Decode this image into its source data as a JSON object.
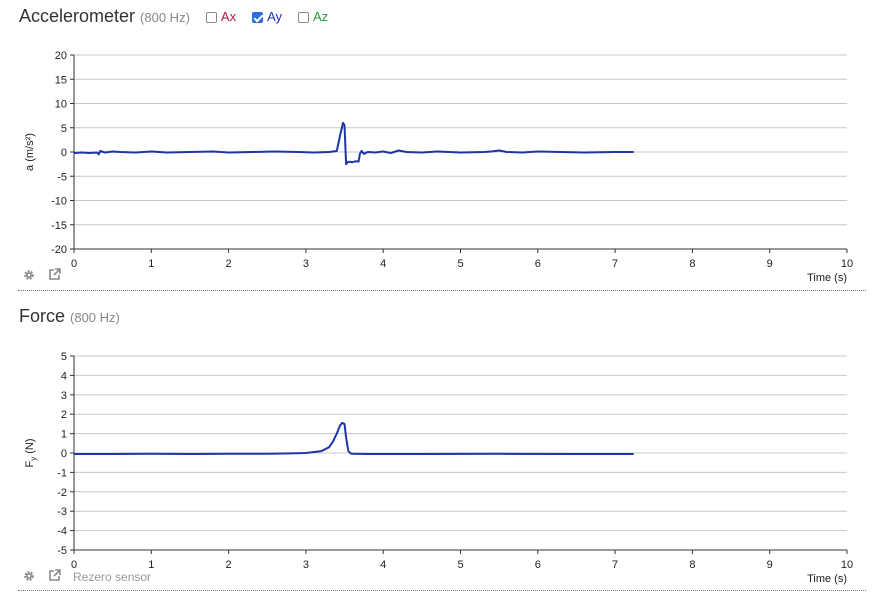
{
  "accelerometer": {
    "title": "Accelerometer",
    "rate": "(800 Hz)",
    "checkboxes": [
      {
        "label": "Ax",
        "checked": false,
        "color": "#c0143c"
      },
      {
        "label": "Ay",
        "checked": true,
        "color": "#1c35a8"
      },
      {
        "label": "Az",
        "checked": false,
        "color": "#2a9a3a"
      }
    ]
  },
  "force": {
    "title": "Force",
    "rate": "(800 Hz)",
    "rezero_label": "Rezero sensor"
  },
  "icons": [
    "gear-icon",
    "external-link-icon"
  ],
  "chart_data": [
    {
      "type": "line",
      "ylabel": "a (m/s²)",
      "xlabel": "Time (s)",
      "xlim": [
        0,
        10
      ],
      "ylim": [
        -20,
        20
      ],
      "xticks": [
        0,
        1,
        2,
        3,
        4,
        5,
        6,
        7,
        8,
        9,
        10
      ],
      "yticks": [
        20,
        15,
        10,
        5,
        0,
        -5,
        -10,
        -15,
        -20
      ],
      "grid": true,
      "series": [
        {
          "name": "Ay",
          "color": "#1c35a8",
          "x": [
            0,
            0.1,
            0.2,
            0.3,
            0.32,
            0.34,
            0.4,
            0.5,
            0.6,
            0.8,
            1.0,
            1.2,
            1.5,
            1.8,
            2.0,
            2.3,
            2.6,
            2.9,
            3.1,
            3.3,
            3.4,
            3.45,
            3.48,
            3.5,
            3.52,
            3.55,
            3.6,
            3.65,
            3.68,
            3.7,
            3.72,
            3.75,
            3.8,
            3.9,
            4.0,
            4.1,
            4.2,
            4.3,
            4.5,
            4.7,
            5.0,
            5.3,
            5.4,
            5.5,
            5.6,
            5.8,
            6.0,
            6.3,
            6.6,
            7.0,
            7.24
          ],
          "y": [
            -0.2,
            -0.1,
            -0.2,
            -0.1,
            -0.5,
            0.2,
            -0.1,
            0.1,
            0,
            -0.1,
            0.1,
            -0.1,
            0,
            0.1,
            -0.1,
            0,
            0.1,
            0,
            -0.1,
            0,
            0.2,
            4.0,
            6.0,
            5.5,
            -2.5,
            -2.0,
            -2.1,
            -1.9,
            -2.0,
            -0.3,
            0.2,
            -0.4,
            0,
            -0.1,
            0.1,
            -0.2,
            0.3,
            0,
            -0.1,
            0.1,
            -0.1,
            0,
            0.1,
            0.3,
            0,
            -0.1,
            0.1,
            0,
            -0.1,
            0,
            0
          ]
        }
      ]
    },
    {
      "type": "line",
      "ylabel": "F",
      "ylabel_sub": "y",
      "ylabel_unit": "(N)",
      "xlabel": "Time (s)",
      "xlim": [
        0,
        10
      ],
      "ylim": [
        -5,
        5
      ],
      "xticks": [
        0,
        1,
        2,
        3,
        4,
        5,
        6,
        7,
        8,
        9,
        10
      ],
      "yticks": [
        5,
        4,
        3,
        2,
        1,
        0,
        -1,
        -2,
        -3,
        -4,
        -5
      ],
      "grid": true,
      "series": [
        {
          "name": "Fy",
          "color": "#1c35a8",
          "x": [
            0,
            0.5,
            1.0,
            1.5,
            2.0,
            2.5,
            2.8,
            3.0,
            3.2,
            3.3,
            3.35,
            3.4,
            3.44,
            3.47,
            3.5,
            3.52,
            3.55,
            3.58,
            3.6,
            3.8,
            4.5,
            5.5,
            6.5,
            7.24
          ],
          "y": [
            -0.05,
            -0.05,
            -0.04,
            -0.05,
            -0.04,
            -0.04,
            -0.02,
            0,
            0.1,
            0.3,
            0.6,
            1.0,
            1.4,
            1.55,
            1.5,
            0.8,
            0.1,
            -0.02,
            -0.04,
            -0.05,
            -0.05,
            -0.04,
            -0.05,
            -0.05
          ]
        }
      ]
    }
  ]
}
